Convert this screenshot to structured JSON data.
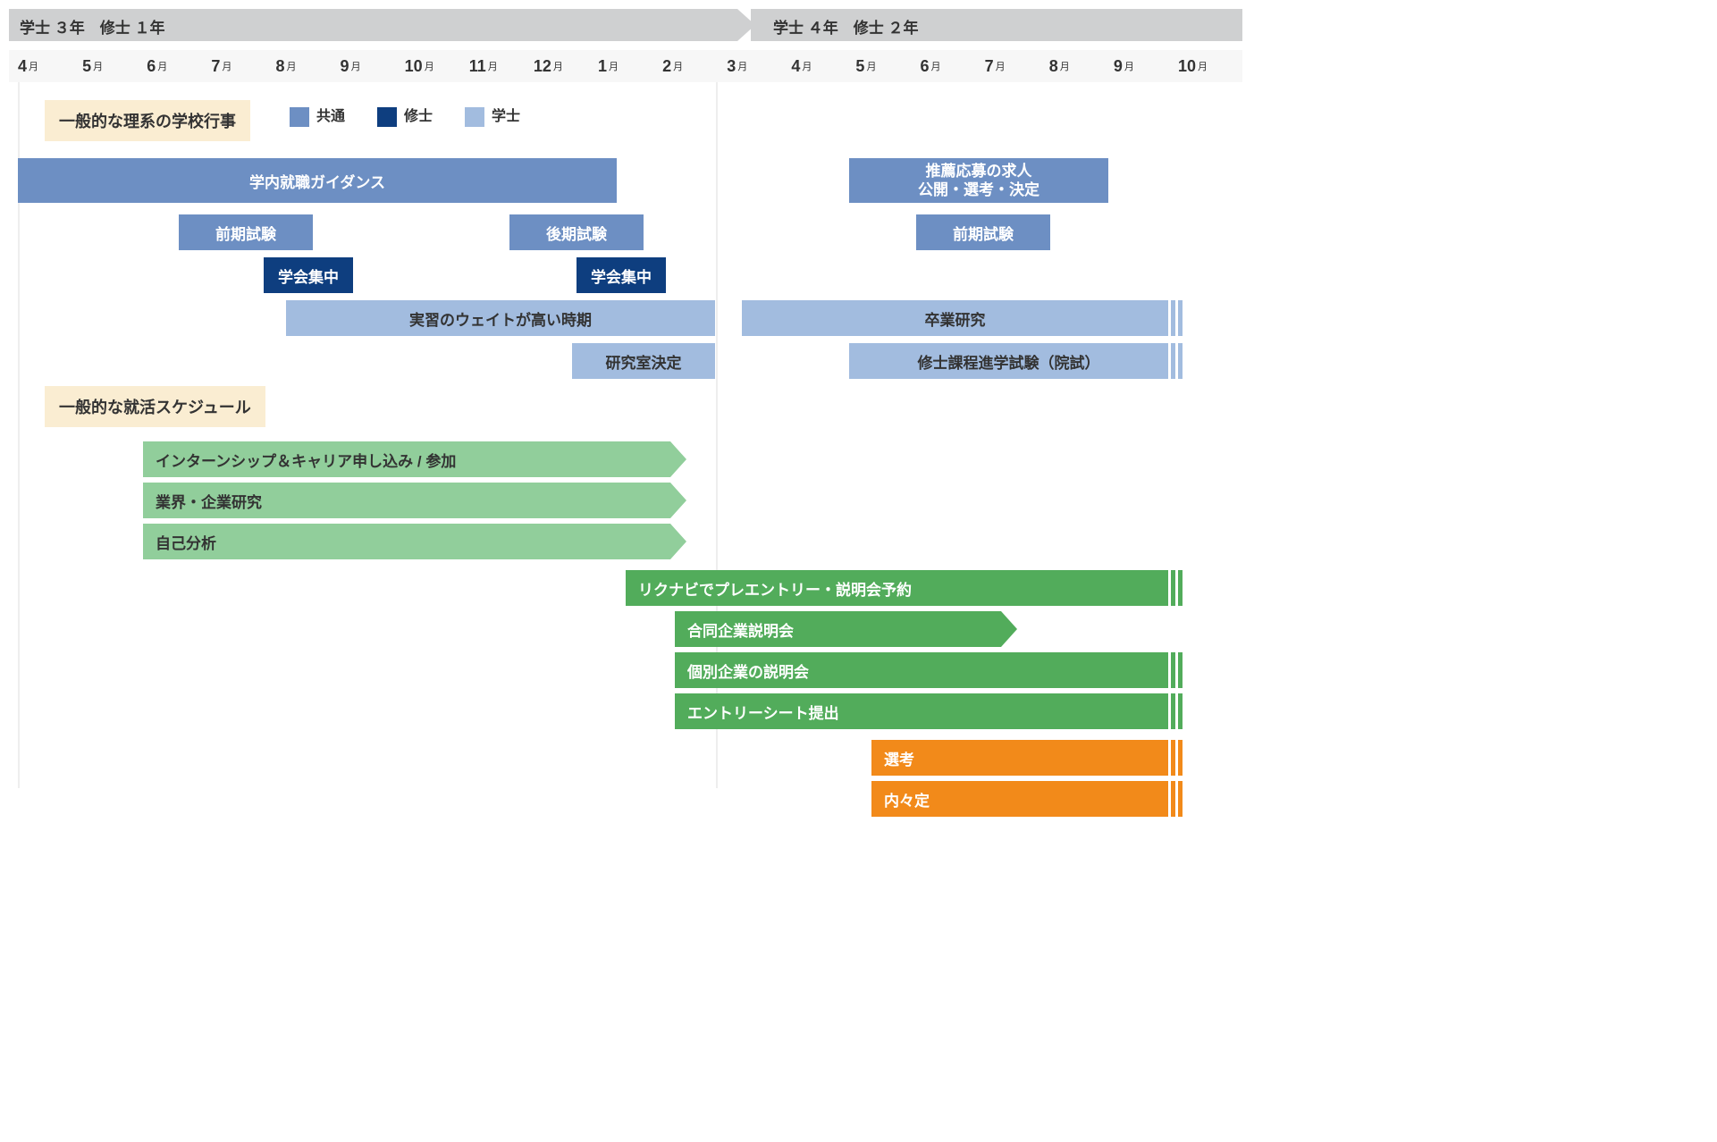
{
  "year_headers": {
    "left": "学士 ３年　修士 １年",
    "right": "学士 ４年　修士 ２年"
  },
  "months": [
    "4",
    "5",
    "6",
    "7",
    "8",
    "9",
    "10",
    "11",
    "12",
    "1",
    "2",
    "3",
    "4",
    "5",
    "6",
    "7",
    "8",
    "9",
    "10"
  ],
  "month_suffix": "月",
  "section1": {
    "title": "一般的な理系の学校行事",
    "legend_common": "共通",
    "legend_master": "修士",
    "legend_bachelor": "学士"
  },
  "school_bars": {
    "guidance": {
      "label": "学内就職ガイダンス"
    },
    "recommend": {
      "label_line1": "推薦応募の求人",
      "label_line2": "公開・選考・決定"
    },
    "exam1": {
      "label": "前期試験"
    },
    "exam2": {
      "label": "後期試験"
    },
    "exam3": {
      "label": "前期試験"
    },
    "conf1": {
      "label": "学会集中"
    },
    "conf2": {
      "label": "学会集中"
    },
    "practice": {
      "label": "実習のウェイトが高い時期"
    },
    "thesis": {
      "label": "卒業研究"
    },
    "labdecide": {
      "label": "研究室決定"
    },
    "gradexam": {
      "label": "修士課程進学試験（院試）"
    }
  },
  "section2": {
    "title": "一般的な就活スケジュール"
  },
  "job_bars": {
    "intern": {
      "label": "インターンシップ＆キャリア申し込み / 参加"
    },
    "industry": {
      "label": "業界・企業研究"
    },
    "self": {
      "label": "自己分析"
    },
    "preentry": {
      "label": "リクナビでプレエントリー・説明会予約"
    },
    "joint": {
      "label": "合同企業説明会"
    },
    "indiv": {
      "label": "個別企業の説明会"
    },
    "es": {
      "label": "エントリーシート提出"
    },
    "selection": {
      "label": "選考"
    },
    "offer": {
      "label": "内々定"
    }
  }
}
